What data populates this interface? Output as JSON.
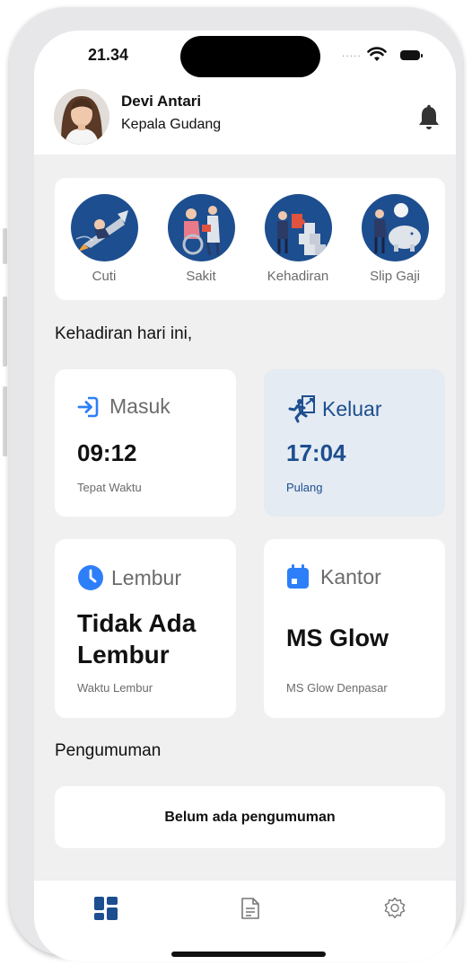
{
  "status_bar": {
    "time": "21.34",
    "signal": "....."
  },
  "profile": {
    "name": "Devi Antari",
    "role": "Kepala Gudang"
  },
  "quick_menu": [
    {
      "label": "Cuti",
      "icon": "rocket-illustration"
    },
    {
      "label": "Sakit",
      "icon": "wheelchair-illustration"
    },
    {
      "label": "Kehadiran",
      "icon": "puzzle-illustration"
    },
    {
      "label": "Slip Gaji",
      "icon": "piggy-bank-illustration"
    }
  ],
  "attendance": {
    "title": "Kehadiran hari ini,",
    "check_in": {
      "label": "Masuk",
      "time": "09:12",
      "note": "Tepat Waktu"
    },
    "check_out": {
      "label": "Keluar",
      "time": "17:04",
      "note": "Pulang"
    },
    "overtime": {
      "label": "Lembur",
      "value": "Tidak Ada Lembur",
      "note": "Waktu Lembur"
    },
    "office": {
      "label": "Kantor",
      "value": "MS Glow",
      "note": "MS Glow Denpasar"
    }
  },
  "announcements": {
    "title": "Pengumuman",
    "empty_text": "Belum ada pengumuman"
  },
  "colors": {
    "primary_blue": "#2d7ff9",
    "navy": "#1d4e8f",
    "check_out_bg": "#e4ebf3",
    "background": "#f0f0f0"
  },
  "nav": [
    {
      "icon": "dashboard-icon",
      "active": true
    },
    {
      "icon": "document-icon",
      "active": false
    },
    {
      "icon": "settings-icon",
      "active": false
    }
  ]
}
